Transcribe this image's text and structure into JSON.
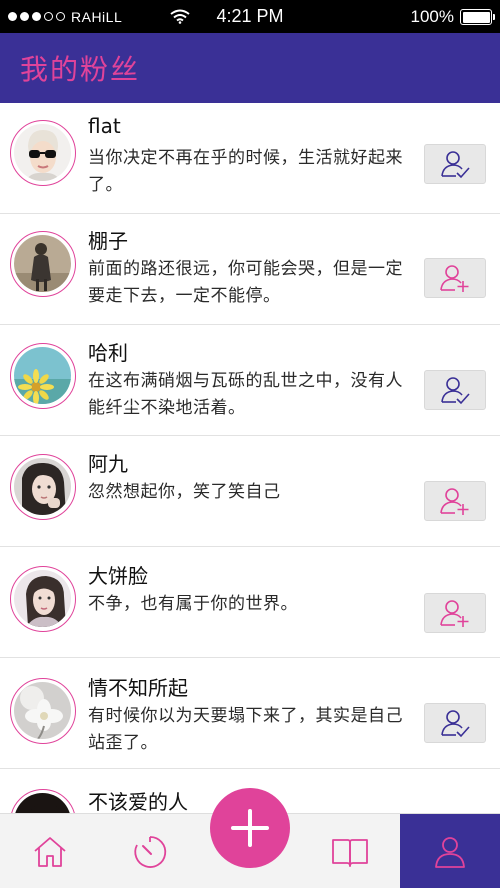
{
  "status_bar": {
    "carrier": "RAHiLL",
    "time": "4:21 PM",
    "battery": "100%",
    "signal_bars": 3,
    "battery_level": 1.0
  },
  "header": {
    "title": "我的粉丝"
  },
  "fans": [
    {
      "name": "flat",
      "desc": "当你决定不再在乎的时候，生活就好起来了。",
      "follow_state": "following",
      "avatar": "avatar-flat"
    },
    {
      "name": "棚子",
      "desc": "前面的路还很远，你可能会哭，但是一定要走下去，一定不能停。",
      "follow_state": "follow",
      "avatar": "avatar-pengzi"
    },
    {
      "name": "哈利",
      "desc": "在这布满硝烟与瓦砾的乱世之中，没有人能纤尘不染地活着。",
      "follow_state": "following",
      "avatar": "avatar-hali"
    },
    {
      "name": "阿九",
      "desc": "忽然想起你，笑了笑自己",
      "follow_state": "follow",
      "avatar": "avatar-ajiu"
    },
    {
      "name": "大饼脸",
      "desc": "不争，也有属于你的世界。",
      "follow_state": "follow",
      "avatar": "avatar-dabinglian"
    },
    {
      "name": "情不知所起",
      "desc": "有时候你以为天要塌下来了，其实是自己站歪了。",
      "follow_state": "following",
      "avatar": "avatar-qingbuzhi"
    },
    {
      "name": "不该爱的人",
      "desc": "",
      "follow_state": "",
      "avatar": "avatar-bugaiai"
    }
  ],
  "tabs": [
    {
      "id": "home",
      "icon": "home-icon"
    },
    {
      "id": "discover",
      "icon": "timer-icon"
    },
    {
      "id": "add",
      "icon": "plus-icon"
    },
    {
      "id": "read",
      "icon": "book-icon"
    },
    {
      "id": "me",
      "icon": "user-icon",
      "active": true
    }
  ],
  "colors": {
    "accent": "#e0439a",
    "primary": "#3a3096",
    "tab_bg": "#f3f3f3",
    "button_bg": "#e8e8e8"
  }
}
